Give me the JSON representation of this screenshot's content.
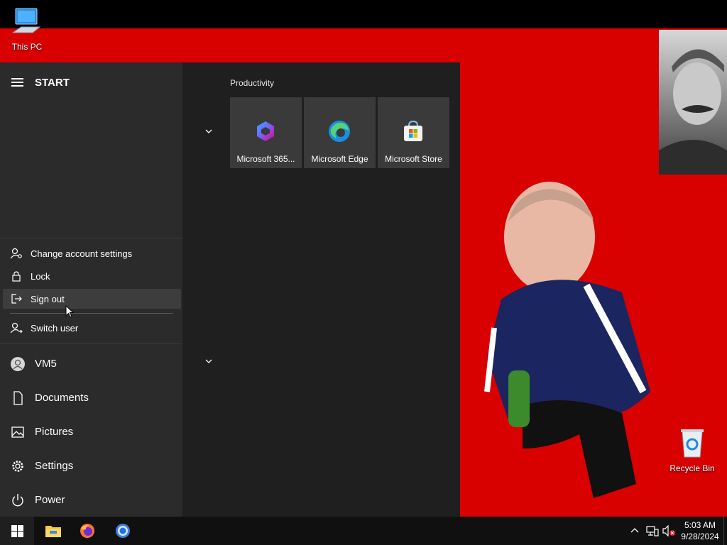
{
  "desktop": {
    "icons": [
      {
        "label": "This PC"
      },
      {
        "label": "Recycle Bin"
      }
    ]
  },
  "start_menu": {
    "title": "START",
    "account_menu": {
      "items": [
        {
          "label": "Change account settings"
        },
        {
          "label": "Lock"
        },
        {
          "label": "Sign out"
        },
        {
          "label": "Switch user"
        }
      ]
    },
    "nav": [
      {
        "label": "VM5"
      },
      {
        "label": "Documents"
      },
      {
        "label": "Pictures"
      },
      {
        "label": "Settings"
      },
      {
        "label": "Power"
      }
    ],
    "group": {
      "name": "Productivity",
      "tiles": [
        {
          "label": "Microsoft 365...",
          "icon": "microsoft-365-icon"
        },
        {
          "label": "Microsoft Edge",
          "icon": "edge-icon"
        },
        {
          "label": "Microsoft Store",
          "icon": "store-icon"
        }
      ]
    }
  },
  "taskbar": {
    "pinned": [
      "file-explorer-icon",
      "firefox-icon",
      "chrome-icon"
    ],
    "clock": {
      "time": "5:03 AM",
      "date": "9/28/2024"
    }
  },
  "colors": {
    "wallpaper": "#d90000",
    "accent": "#0078d4"
  }
}
